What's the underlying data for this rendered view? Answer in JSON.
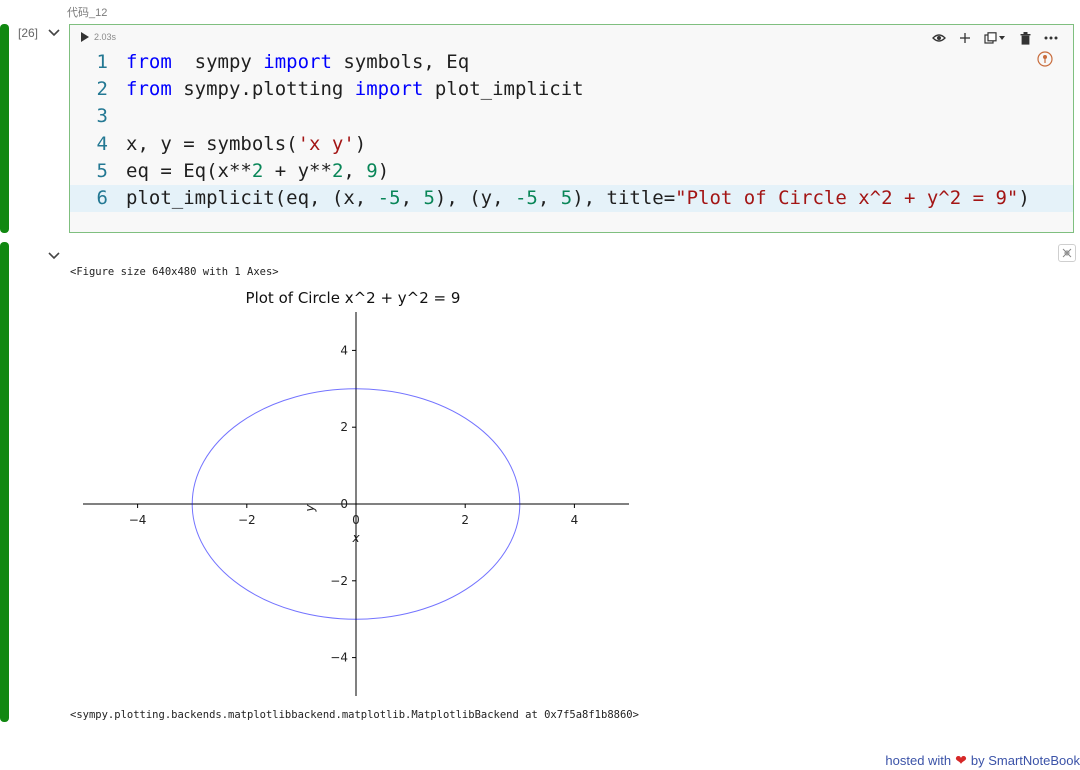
{
  "cell_label": "代码_12",
  "execution_count": "[26]",
  "run_time": "2.03s",
  "toolbar_icons": [
    "eye-icon",
    "plus-icon",
    "copy-icon",
    "dropdown-icon",
    "trash-icon",
    "more-icon"
  ],
  "code_lines": [
    {
      "n": "1",
      "parts": [
        [
          "kw",
          "from"
        ],
        [
          "",
          "  sympy "
        ],
        [
          "kw",
          "import"
        ],
        [
          "",
          " symbols, Eq"
        ]
      ]
    },
    {
      "n": "2",
      "parts": [
        [
          "kw",
          "from"
        ],
        [
          "",
          " sympy.plotting "
        ],
        [
          "kw",
          "import"
        ],
        [
          "",
          " plot_implicit"
        ]
      ]
    },
    {
      "n": "3",
      "parts": []
    },
    {
      "n": "4",
      "parts": [
        [
          "",
          "x, y = symbols("
        ],
        [
          "str",
          "'x y'"
        ],
        [
          "",
          ")"
        ]
      ]
    },
    {
      "n": "5",
      "parts": [
        [
          "",
          "eq = Eq(x**"
        ],
        [
          "num",
          "2"
        ],
        [
          "",
          " + y**"
        ],
        [
          "num",
          "2"
        ],
        [
          "",
          ", "
        ],
        [
          "num",
          "9"
        ],
        [
          "",
          ")"
        ]
      ]
    },
    {
      "n": "6",
      "parts": [
        [
          "",
          "plot_implicit(eq, (x, "
        ],
        [
          "num",
          "-5"
        ],
        [
          "",
          ", "
        ],
        [
          "num",
          "5"
        ],
        [
          "",
          "), (y, "
        ],
        [
          "num",
          "-5"
        ],
        [
          "",
          ", "
        ],
        [
          "num",
          "5"
        ],
        [
          "",
          "), title="
        ],
        [
          "str",
          "\"Plot of Circle x^2 + y^2 = 9\""
        ],
        [
          "",
          ")"
        ]
      ]
    }
  ],
  "output": {
    "figure_size_text": "<Figure size 640x480 with 1 Axes>",
    "return_text": "<sympy.plotting.backends.matplotlibbackend.matplotlib.MatplotlibBackend at 0x7f5a8f1b8860>"
  },
  "footer": {
    "prefix": "hosted with",
    "suffix": "by SmartNoteBook"
  },
  "colors": {
    "accent_bar": "#118811",
    "curve": "#0000ff"
  },
  "chart_data": {
    "type": "line",
    "title": "Plot of Circle x^2 + y^2 = 9",
    "xlabel": "x",
    "ylabel": "y",
    "xlim": [
      -5,
      5
    ],
    "ylim": [
      -5,
      5
    ],
    "xticks": [
      -4,
      -2,
      0,
      2,
      4
    ],
    "yticks": [
      -4,
      -2,
      0,
      2,
      4
    ],
    "series": [
      {
        "shape": "circle",
        "center": [
          0,
          0
        ],
        "radius": 3
      }
    ]
  }
}
